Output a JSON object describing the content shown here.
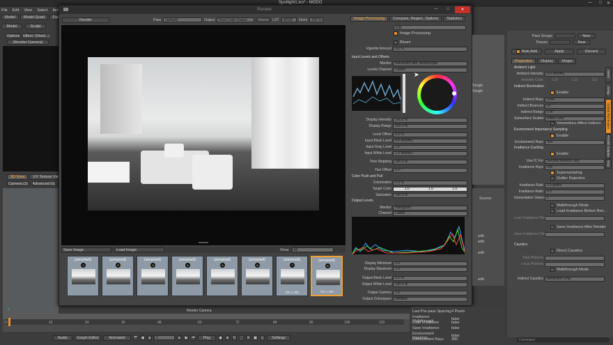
{
  "app": {
    "title": "Spotlight1.lxo* - MODO",
    "menu": [
      "File",
      "Edit",
      "View",
      "Select",
      "Item"
    ]
  },
  "left": {
    "tabs": [
      "Model",
      "Model Quad",
      "Fur"
    ],
    "mode_model": "Model",
    "mode_sculpt": "Sculpt",
    "toolbar": [
      "Options",
      "Effect: (Shad...)"
    ],
    "render_camera": "(Render Camera)",
    "view_tabs": [
      "3D View",
      "UV Texture View"
    ],
    "view_items": [
      "Camera (2)",
      "Advanced Op"
    ]
  },
  "render_window": {
    "title": "Render",
    "pass_label": "Pass",
    "pass_value": "(default)",
    "output_label": "Output",
    "output_value": "Final Color Output",
    "stereo": "Stereo",
    "lut_label": "LUT",
    "lut_value": "sRGB",
    "zoom_label": "Zoom",
    "zoom_value": "100 %",
    "save_image": "Save Image",
    "load_image": "Load Image",
    "show_label": "Show",
    "show_value": "All"
  },
  "thumbs": [
    {
      "label": "(unnamed)",
      "num": "1",
      "size": ""
    },
    {
      "label": "(unnamed)",
      "num": "2",
      "size": ""
    },
    {
      "label": "(unnamed)",
      "num": "3",
      "size": ""
    },
    {
      "label": "(unnamed)",
      "num": "4",
      "size": ""
    },
    {
      "label": "(unnamed)",
      "num": "5",
      "size": ""
    },
    {
      "label": "(unnamed)",
      "num": "6",
      "size": ""
    },
    {
      "label": "(unnamed)",
      "num": "7",
      "size": "720 x 480"
    },
    {
      "label": "(unnamed)",
      "num": "8",
      "size": "720 x 480"
    }
  ],
  "ip": {
    "tabs": [
      "Image Processing",
      "Compare, Region, Options",
      "Statistics"
    ],
    "edit": "Edit",
    "image_processing": "Image Processing",
    "bloom": "Bloom",
    "vignette_label": "Vignette Amount",
    "vignette_value": "0.0 %",
    "levels_section": "Input Levels and Offsets",
    "monitor_label": "Monitor",
    "monitor_value": "Waveform and Vectorscope",
    "levels_channel_label": "Levels Channel",
    "levels_channel_value": "Colors",
    "rows1": [
      {
        "l": "Display Intensity",
        "v": "100.0 %"
      },
      {
        "l": "Display Range",
        "v": "100.0 %"
      },
      {
        "l": "Level Offset",
        "v": "0.0 %"
      },
      {
        "l": "Input Black Level",
        "v": "0.0 W/srm2"
      },
      {
        "l": "Input Gray Level",
        "v": "1.0"
      },
      {
        "l": "Input White Level",
        "v": "1.0 W/srm2"
      },
      {
        "l": "Tone Mapping",
        "v": "100.0 %"
      },
      {
        "l": "Hue Offset",
        "v": "0.0 °"
      }
    ],
    "color_push": "Color Push and Pull",
    "colorization_label": "Colorization",
    "colorization_value": "0.0 %",
    "target_color_label": "Target Color",
    "target_color": [
      "1.0",
      "1.0",
      "1.0"
    ],
    "saturation_label": "Saturation",
    "saturation_value": "100.0 %",
    "output_section": "Output Levels",
    "monitor2_value": "Histogram",
    "channel_label": "Channel",
    "channel_value": "Colors",
    "rows2": [
      {
        "l": "Display Minimum",
        "v": "0.0"
      },
      {
        "l": "Display Maximum",
        "v": "1.0"
      },
      {
        "l": "Output Black Level",
        "v": "0.0 %"
      },
      {
        "l": "Output White Level",
        "v": "100.0 %"
      },
      {
        "l": "Output Gamma",
        "v": "1.0"
      },
      {
        "l": "Output Colorspace",
        "v": "(default)"
      }
    ]
  },
  "right": {
    "pass_groups": "Pass Groups",
    "passes": "Passes",
    "new_btn": "New",
    "auto_add": "Auto Add",
    "apply": "Apply",
    "discard": "Discard",
    "tabs": [
      "Properties",
      "Display",
      "Shape"
    ],
    "ambient": "Ambient Light",
    "ambient_intensity_label": "Ambient Intensity",
    "ambient_intensity": "0.0 W/srm2",
    "ambient_color_label": "Ambient Color",
    "ambient_color": [
      "1.0",
      "1.0",
      "1.0"
    ],
    "indirect": "Indirect Illumination",
    "enable": "Enable",
    "indirect_rays_label": "Indirect Rays",
    "indirect_rays": "1000",
    "indirect_bounces_label": "Indirect Bounces",
    "indirect_bounces": "10",
    "indirect_range_label": "Indirect Range",
    "indirect_range": "0 m",
    "subsurface_label": "Subsurface Scatter...",
    "subsurface": "Direct Only",
    "volumetrics": "Volumetrics Affect Indirect",
    "env": "Environment Importance Sampling",
    "env_rays_label": "Environment Rays",
    "env_rays": "300",
    "irr": "Irradiance Caching",
    "use_ic_label": "Use IC For",
    "use_ic": "Second Bounce Only",
    "irr_rays_label": "Irradiance Rays",
    "irr_rays": "256",
    "supersampling": "Supersampling",
    "outlier": "Outlier Rejection",
    "irr_rate_label": "Irradiance Rate",
    "irr_rate": "2.5 pixels",
    "irr_ratio_label": "Irradiance Ratio",
    "irr_ratio": "6.0",
    "interp_label": "Interpolation Values",
    "interp": "1",
    "walkthrough": "Walkthrough Mode",
    "load_before": "Load Irradiance Before Ren...",
    "load_file": "Load Irradiance File",
    "save_after": "Save Irradiance After Render",
    "save_file": "Save Irradiance File",
    "caustics": "Caustics",
    "direct_caustics": "Direct Caustics",
    "total_photons": "Total Photons",
    "local_photons": "Local Photons",
    "walkthrough2": "Walkthrough Mode",
    "indirect_caustics_label": "Indirect Caustics",
    "indirect_caustics": "Refraction Only",
    "side_tabs": [
      "Mesh",
      "Setup",
      "Global Illumination",
      "Render Outputs",
      "Vray"
    ]
  },
  "list": {
    "single1": "Single",
    "single2": "Single",
    "source": "Source",
    "edits": [
      "edit",
      "edit",
      "edit",
      "edit"
    ],
    "rows": [
      {
        "name": "Last Pre-pass Spacing",
        "val": "4 Pixels"
      },
      {
        "name": "Irradiance Walkthrough...",
        "val": "false"
      },
      {
        "name": "Load Irradiance",
        "val": "false"
      },
      {
        "name": "Save Irradiance",
        "val": "false"
      },
      {
        "name": "Environment Importan...",
        "val": "false"
      },
      {
        "name": "Environment Rays",
        "val": "300"
      }
    ]
  },
  "timeline": {
    "ticks": [
      "0",
      "12",
      "24",
      "36",
      "48",
      "60",
      "72",
      "84",
      "96",
      "108",
      "120"
    ],
    "render_camera": "Render Camera",
    "buttons": [
      "Audio",
      "Graph Editor",
      "Animated",
      "Play",
      "Settings"
    ],
    "frame": "0",
    "command_placeholder": "Command"
  }
}
